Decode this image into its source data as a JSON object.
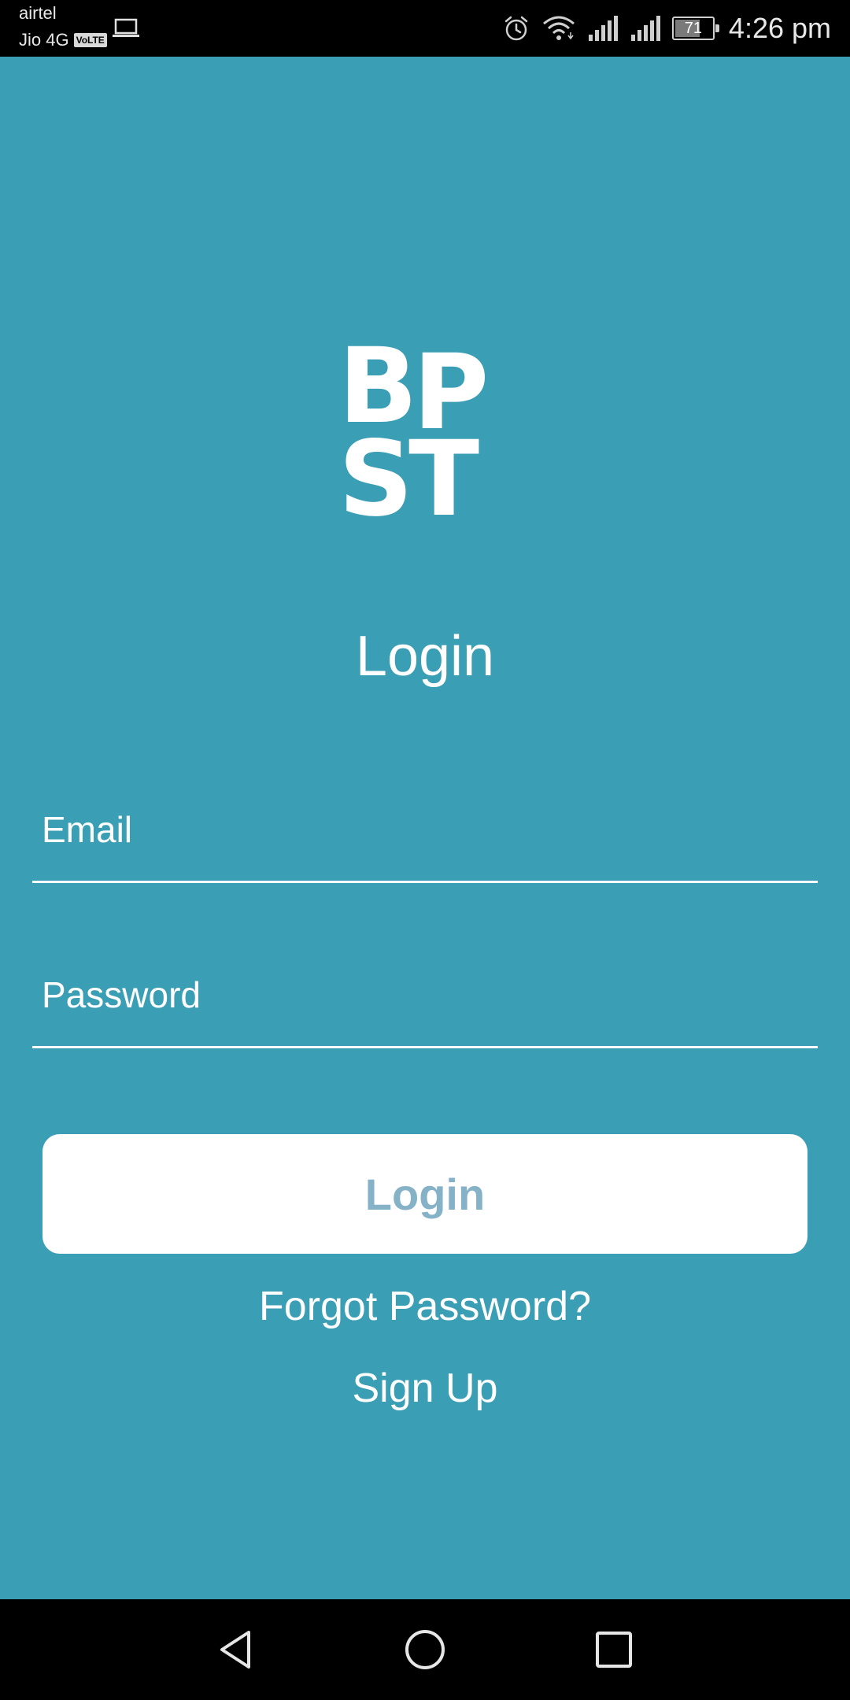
{
  "status_bar": {
    "carrier_primary": "airtel",
    "carrier_secondary": "Jio 4G",
    "volte_badge": "VoLTE",
    "battery_level": "71",
    "time": "4:26 pm",
    "icons": [
      "laptop-icon",
      "alarm-icon",
      "wifi-icon",
      "signal-icon",
      "signal-icon",
      "battery-icon"
    ]
  },
  "app": {
    "background_color": "#3a9eb5",
    "logo": {
      "row1": [
        "B",
        "P"
      ],
      "row2": [
        "S",
        "T"
      ]
    },
    "title": "Login",
    "email_placeholder": "Email",
    "password_placeholder": "Password",
    "login_button_label": "Login",
    "login_button_text_color": "#86b2c8",
    "forgot_password_label": "Forgot Password?",
    "signup_label": "Sign Up"
  },
  "nav_bar": {
    "icons": [
      "back-icon",
      "home-icon",
      "recent-apps-icon"
    ]
  }
}
